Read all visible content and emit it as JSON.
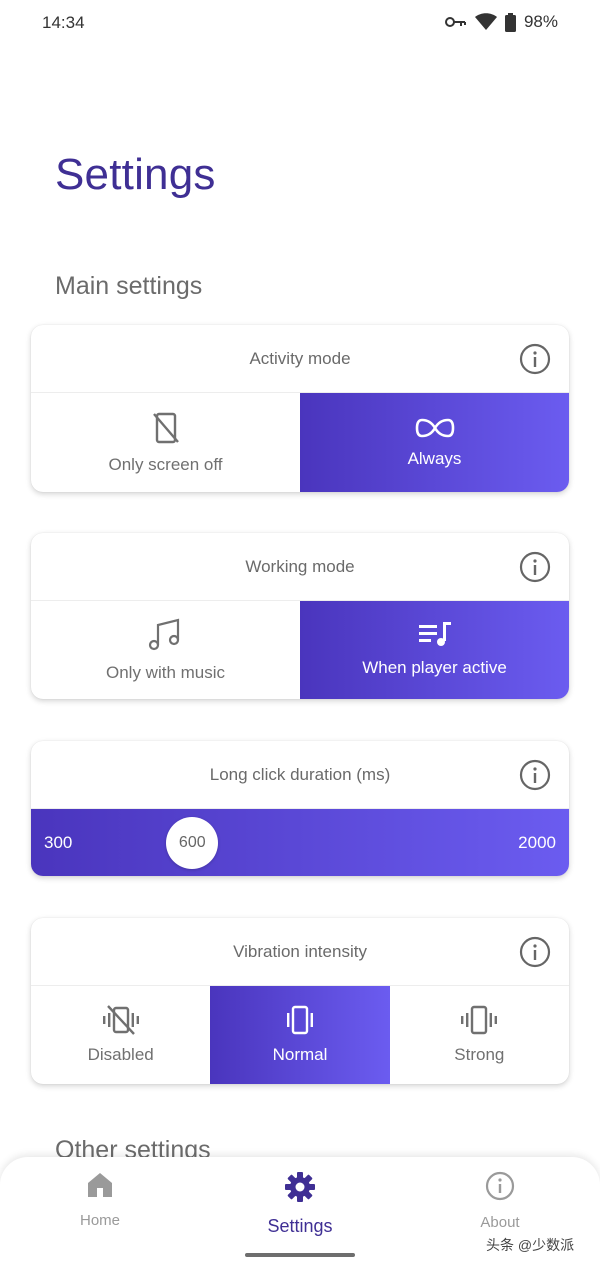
{
  "status_bar": {
    "time": "14:34",
    "battery": "98%",
    "icons": [
      "vpn-key-icon",
      "wifi-icon",
      "battery-icon"
    ]
  },
  "page": {
    "title": "Settings"
  },
  "sections": {
    "main": "Main settings",
    "other": "Other settings"
  },
  "activity_mode": {
    "title": "Activity mode",
    "options": [
      {
        "label": "Only screen off",
        "icon": "screen-off-icon",
        "selected": false
      },
      {
        "label": "Always",
        "icon": "infinity-icon",
        "selected": true
      }
    ]
  },
  "working_mode": {
    "title": "Working mode",
    "options": [
      {
        "label": "Only with music",
        "icon": "music-note-icon",
        "selected": false
      },
      {
        "label": "When player active",
        "icon": "playlist-icon",
        "selected": true
      }
    ]
  },
  "long_click": {
    "title": "Long click duration (ms)",
    "min": "300",
    "max": "2000",
    "value": "600"
  },
  "vibration": {
    "title": "Vibration intensity",
    "options": [
      {
        "label": "Disabled",
        "icon": "vibration-off-icon",
        "selected": false
      },
      {
        "label": "Normal",
        "icon": "vibration-icon",
        "selected": true
      },
      {
        "label": "Strong",
        "icon": "vibration-strong-icon",
        "selected": false
      }
    ]
  },
  "nav": {
    "home": "Home",
    "settings": "Settings",
    "about": "About",
    "active": "settings"
  },
  "watermark": "头条 @少数派",
  "colors": {
    "accent": "#4a35bd",
    "accent_light": "#6b5cf0",
    "title": "#3f2f94"
  }
}
